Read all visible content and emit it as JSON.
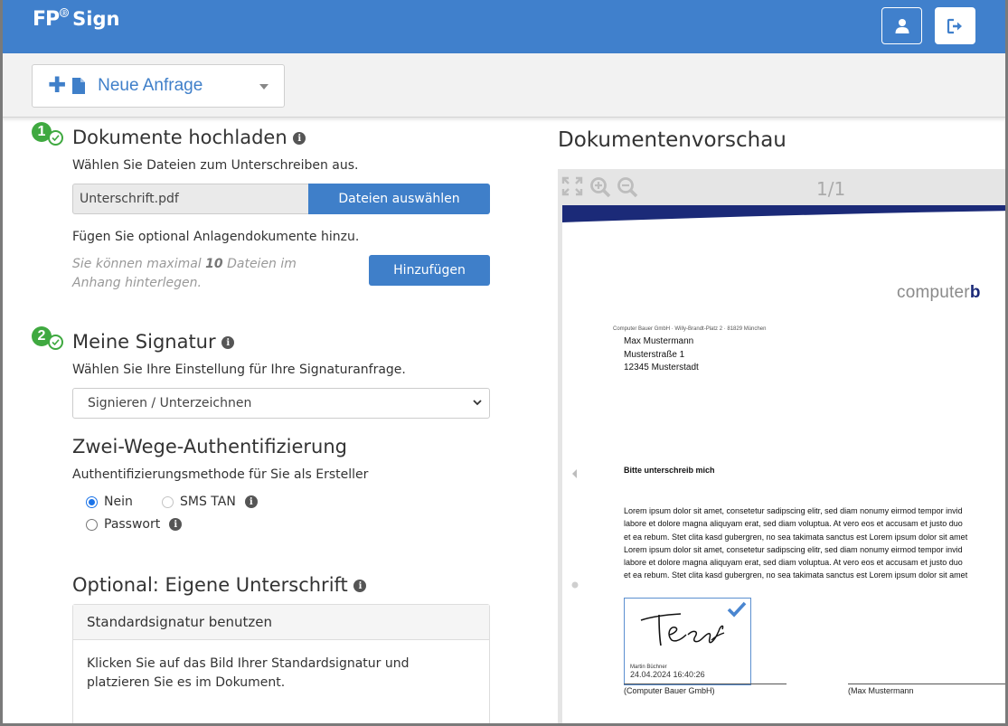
{
  "header": {
    "logo_fp": "FP",
    "logo_reg": "®",
    "logo_sign": "Sign",
    "user_icon": "user-icon",
    "logout_icon": "logout-icon"
  },
  "toolbar": {
    "new_request_label": "Neue Anfrage"
  },
  "step1": {
    "number": "1",
    "title": "Dokumente hochladen",
    "subtitle": "Wählen Sie Dateien zum Unterschreiben aus.",
    "file_value": "Unterschrift.pdf",
    "choose_files_label": "Dateien auswählen",
    "attachments_text": "Fügen Sie optional Anlagendokumente hinzu.",
    "hint_prefix": "Sie können maximal ",
    "hint_count": "10",
    "hint_suffix": " Dateien im Anhang hinterlegen.",
    "add_label": "Hinzufügen"
  },
  "step2": {
    "number": "2",
    "title": "Meine Signatur",
    "subtitle": "Wählen Sie Ihre Einstellung für Ihre Signaturanfrage.",
    "select_value": "Signieren / Unterzeichnen"
  },
  "auth": {
    "title": "Zwei-Wege-Authentifizierung",
    "subtitle": "Authentifizierungsmethode für Sie als Ersteller",
    "options": [
      {
        "label": "Nein",
        "checked": true
      },
      {
        "label": "SMS TAN",
        "checked": false,
        "disabled": true
      },
      {
        "label": "Passwort",
        "checked": false
      }
    ]
  },
  "own_signature": {
    "title": "Optional: Eigene Unterschrift",
    "panel_header": "Standardsignatur benutzen",
    "panel_body": "Klicken Sie auf das Bild Ihrer Standardsignatur und platzieren Sie es im Dokument."
  },
  "preview": {
    "title": "Dokumentenvorschau",
    "page_indicator": "1/1",
    "document": {
      "logo_main": "computer",
      "logo_tail": "b",
      "sender_line": "Computer Bauer GmbH · Willy-Brandt-Platz 2 · 81829 München",
      "recipient": [
        "Max Mustermann",
        "Musterstraße 1",
        "12345 Musterstadt"
      ],
      "heading": "Bitte unterschreib mich",
      "body_lines": [
        "Lorem ipsum dolor sit amet, consetetur sadipscing elitr, sed diam nonumy eirmod tempor invid",
        "labore et dolore magna aliquyam erat, sed diam voluptua. At vero eos et accusam et justo duo",
        "et ea rebum. Stet clita kasd gubergren, no sea takimata sanctus est Lorem ipsum dolor sit amet",
        "Lorem ipsum dolor sit amet, consetetur sadipscing elitr, sed diam nonumy eirmod tempor invid",
        "labore et dolore magna aliquyam erat, sed diam voluptua. At vero eos et accusam et justo duo",
        "et ea rebum. Stet clita kasd gubergren, no sea takimata sanctus est Lorem ipsum dolor sit amet"
      ],
      "signature_name": "Martin Büchner",
      "signature_date": "24.04.2024 16:40:26",
      "caption_left": "(Computer Bauer GmbH)",
      "caption_right": "(Max Mustermann"
    }
  },
  "colors": {
    "header_bg": "#4080cc",
    "accent": "#3f7fc9",
    "step_green": "#3fa940",
    "doc_navy": "#1b2a78"
  }
}
